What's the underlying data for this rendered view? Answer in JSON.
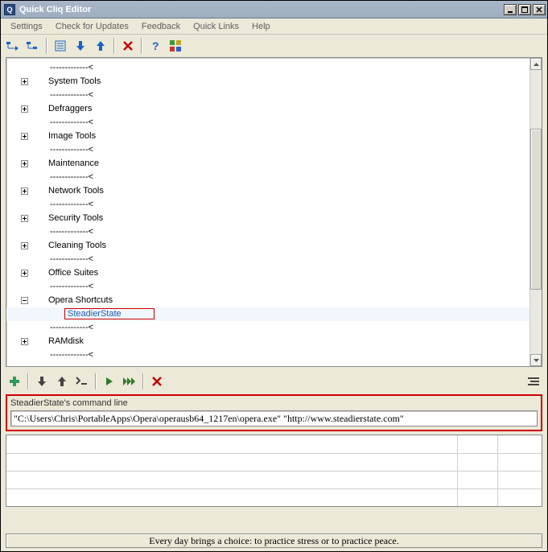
{
  "title": "Quick Cliq Editor",
  "menu": [
    "Settings",
    "Check for Updates",
    "Feedback",
    "Quick Links",
    "Help"
  ],
  "toolbar_icons": [
    "tree-collapse-icon",
    "tree-expand-icon",
    "sep",
    "list-icon",
    "arrow-down-blue-icon",
    "arrow-up-blue-icon",
    "sep",
    "delete-x-icon",
    "sep",
    "help-icon",
    "apps-icon"
  ],
  "tree": [
    {
      "type": "sep",
      "label": "-------------<"
    },
    {
      "type": "folder",
      "label": "System Tools"
    },
    {
      "type": "sep",
      "label": "-------------<"
    },
    {
      "type": "folder",
      "label": "Defraggers"
    },
    {
      "type": "sep",
      "label": "-------------<"
    },
    {
      "type": "folder",
      "label": "Image Tools"
    },
    {
      "type": "sep",
      "label": "-------------<"
    },
    {
      "type": "folder",
      "label": "Maintenance"
    },
    {
      "type": "sep",
      "label": "-------------<"
    },
    {
      "type": "folder",
      "label": "Network Tools"
    },
    {
      "type": "sep",
      "label": "-------------<"
    },
    {
      "type": "folder",
      "label": "Security Tools"
    },
    {
      "type": "sep",
      "label": "-------------<"
    },
    {
      "type": "folder",
      "label": "Cleaning Tools"
    },
    {
      "type": "sep",
      "label": "-------------<"
    },
    {
      "type": "folder",
      "label": "Office Suites"
    },
    {
      "type": "sep",
      "label": "-------------<"
    },
    {
      "type": "folder",
      "label": "Opera Shortcuts",
      "expanded": true
    },
    {
      "type": "child",
      "label": "SteadierState"
    },
    {
      "type": "sep",
      "label": "-------------<"
    },
    {
      "type": "folder",
      "label": "RAMdisk"
    },
    {
      "type": "sep",
      "label": "-------------<"
    }
  ],
  "lower_toolbar_icons_left": [
    "plus-icon",
    "sep",
    "arrow-down-icon",
    "arrow-up-icon",
    "prompt-icon",
    "sep",
    "play-icon",
    "fast-forward-icon",
    "sep",
    "delete-x-icon"
  ],
  "lower_toolbar_icons_right": [
    "align-icon"
  ],
  "command": {
    "label": "SteadierState's command line",
    "value": "\"C:\\Users\\Chris\\PortableApps\\Opera\\operausb64_1217en\\opera.exe\" \"http://www.steadierstate.com\""
  },
  "status": "Every day brings a choice: to practice stress or to practice peace."
}
